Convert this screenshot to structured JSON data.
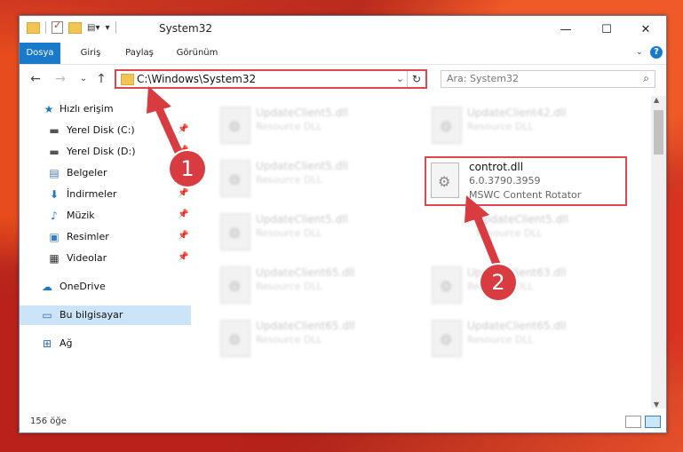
{
  "window": {
    "title": "System32",
    "controls": {
      "minimize": "—",
      "maximize": "☐",
      "close": "✕"
    }
  },
  "ribbon": {
    "tabs": [
      "Dosya",
      "Giriş",
      "Paylaş",
      "Görünüm"
    ],
    "help": "?"
  },
  "nav": {
    "back": "←",
    "forward": "→",
    "recent": "⌄",
    "up": "↑",
    "address": "C:\\Windows\\System32",
    "search_placeholder": "Ara: System32"
  },
  "sidebar": {
    "items": [
      {
        "label": "Hızlı erişim",
        "icon": "star-icon",
        "pinned": false
      },
      {
        "label": "Yerel Disk (C:)",
        "icon": "drive-icon",
        "pinned": true
      },
      {
        "label": "Yerel Disk (D:)",
        "icon": "drive-icon",
        "pinned": true
      },
      {
        "label": "Belgeler",
        "icon": "documents-icon",
        "pinned": true
      },
      {
        "label": "İndirmeler",
        "icon": "download-icon",
        "pinned": true
      },
      {
        "label": "Müzik",
        "icon": "music-icon",
        "pinned": true
      },
      {
        "label": "Resimler",
        "icon": "pictures-icon",
        "pinned": true
      },
      {
        "label": "Videolar",
        "icon": "video-icon",
        "pinned": true
      },
      {
        "label": "OneDrive",
        "icon": "cloud-icon",
        "pinned": false
      },
      {
        "label": "Bu bilgisayar",
        "icon": "computer-icon",
        "pinned": false,
        "selected": true
      },
      {
        "label": "Ağ",
        "icon": "network-icon",
        "pinned": false
      }
    ]
  },
  "files": [
    {
      "name": "UpdateClient5.dll",
      "type": "Resource DLL"
    },
    {
      "name": "UpdateClient42.dll",
      "type": "Resource DLL"
    },
    {
      "name": "UpdateClient5.dll",
      "type": "Resource DLL"
    },
    {
      "name": "UpdateClient5.dll",
      "type": "Resource DLL"
    },
    {
      "name": "UpdateClient5.dll",
      "type": "Resource DLL"
    },
    {
      "name": "UpdateClient65.dll",
      "type": "Resource DLL"
    },
    {
      "name": "UpdateClient63.dll",
      "type": "Resource DLL"
    },
    {
      "name": "UpdateClient65.dll",
      "type": "Resource DLL"
    },
    {
      "name": "UpdateClient65.dll",
      "type": "Resource DLL"
    }
  ],
  "highlighted_file": {
    "name": "controt.dll",
    "version": "6.0.3790.3959",
    "description": "MSWC Content Rotator"
  },
  "status": {
    "item_count": "156 öğe"
  },
  "annotations": {
    "step1": "1",
    "step2": "2"
  },
  "colors": {
    "accent": "#1979ca",
    "highlight": "#e0474c"
  }
}
